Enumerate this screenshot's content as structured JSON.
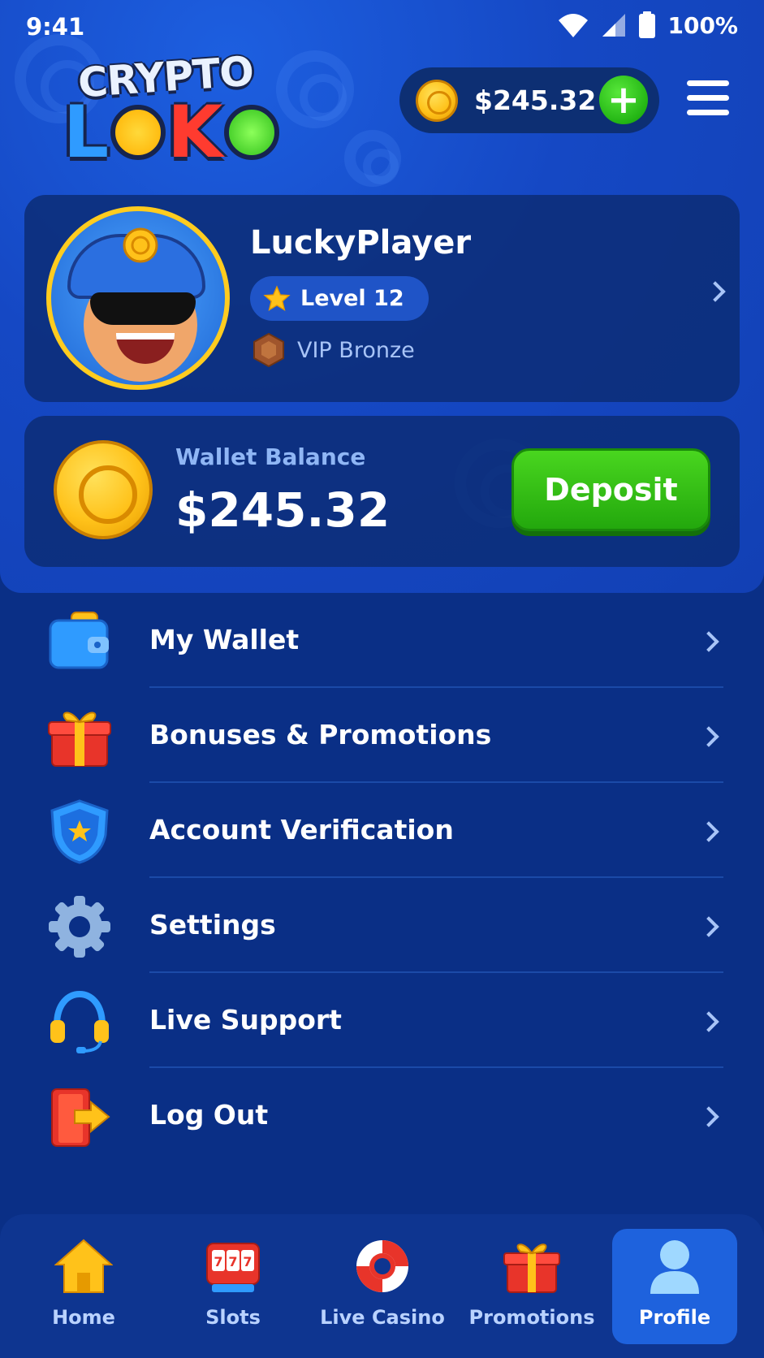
{
  "status_bar": {
    "time": "9:41",
    "battery": "100%"
  },
  "header": {
    "logo_top": "CRYPTO",
    "logo_bottom_letters": [
      "L",
      "K"
    ],
    "balance": "$245.32",
    "add_funds_label": "+"
  },
  "profile": {
    "username": "LuckyPlayer",
    "level": "Level 12",
    "vip": "VIP Bronze"
  },
  "wallet": {
    "label": "Wallet Balance",
    "amount": "$245.32",
    "deposit_label": "Deposit"
  },
  "menu": {
    "items": [
      {
        "label": "My Wallet",
        "icon": "wallet-icon"
      },
      {
        "label": "Bonuses & Promotions",
        "icon": "gift-icon"
      },
      {
        "label": "Account Verification",
        "icon": "shield-icon"
      },
      {
        "label": "Settings",
        "icon": "gear-icon"
      },
      {
        "label": "Live Support",
        "icon": "headset-icon"
      },
      {
        "label": "Log Out",
        "icon": "logout-icon"
      }
    ]
  },
  "bottom_nav": {
    "items": [
      {
        "label": "Home",
        "icon": "home-icon"
      },
      {
        "label": "Slots",
        "icon": "slot-machine-icon"
      },
      {
        "label": "Live Casino",
        "icon": "lifebuoy-icon"
      },
      {
        "label": "Promotions",
        "icon": "gift-icon"
      },
      {
        "label": "Profile",
        "icon": "user-icon"
      }
    ],
    "active": "Profile"
  },
  "colors": {
    "background": "#0a2f86",
    "card": "#0c2d76",
    "accent_green": "#23a80d",
    "coin_gold": "#ffc21a",
    "active_tab": "#1e62dd"
  }
}
